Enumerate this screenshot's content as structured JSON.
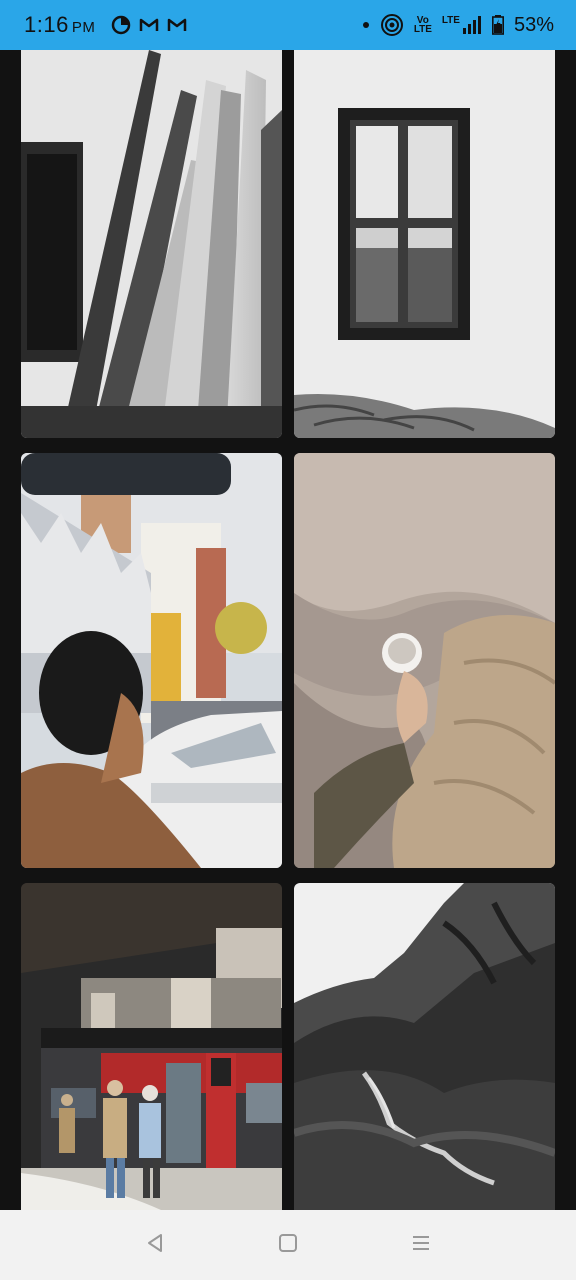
{
  "status_bar": {
    "time": "1:16",
    "ampm": "PM",
    "notification_icons": [
      "data-saver-icon",
      "gmail-icon",
      "gmail-icon"
    ],
    "network_label": "LTE",
    "volte_label": "Vo LTE",
    "battery_percent": "53%",
    "background": "#2aa6e8"
  },
  "gallery": {
    "photos": [
      {
        "subject": "surfboards",
        "style": "black-and-white"
      },
      {
        "subject": "window-on-white-wall",
        "style": "black-and-white"
      },
      {
        "subject": "woman-on-city-street",
        "style": "color"
      },
      {
        "subject": "cup-on-bed",
        "style": "color"
      },
      {
        "subject": "train-station",
        "style": "color"
      },
      {
        "subject": "mountain-waterfall",
        "style": "black-and-white"
      }
    ]
  },
  "nav_bar": {
    "buttons": [
      "back-icon",
      "home-icon",
      "recents-menu-icon"
    ]
  }
}
